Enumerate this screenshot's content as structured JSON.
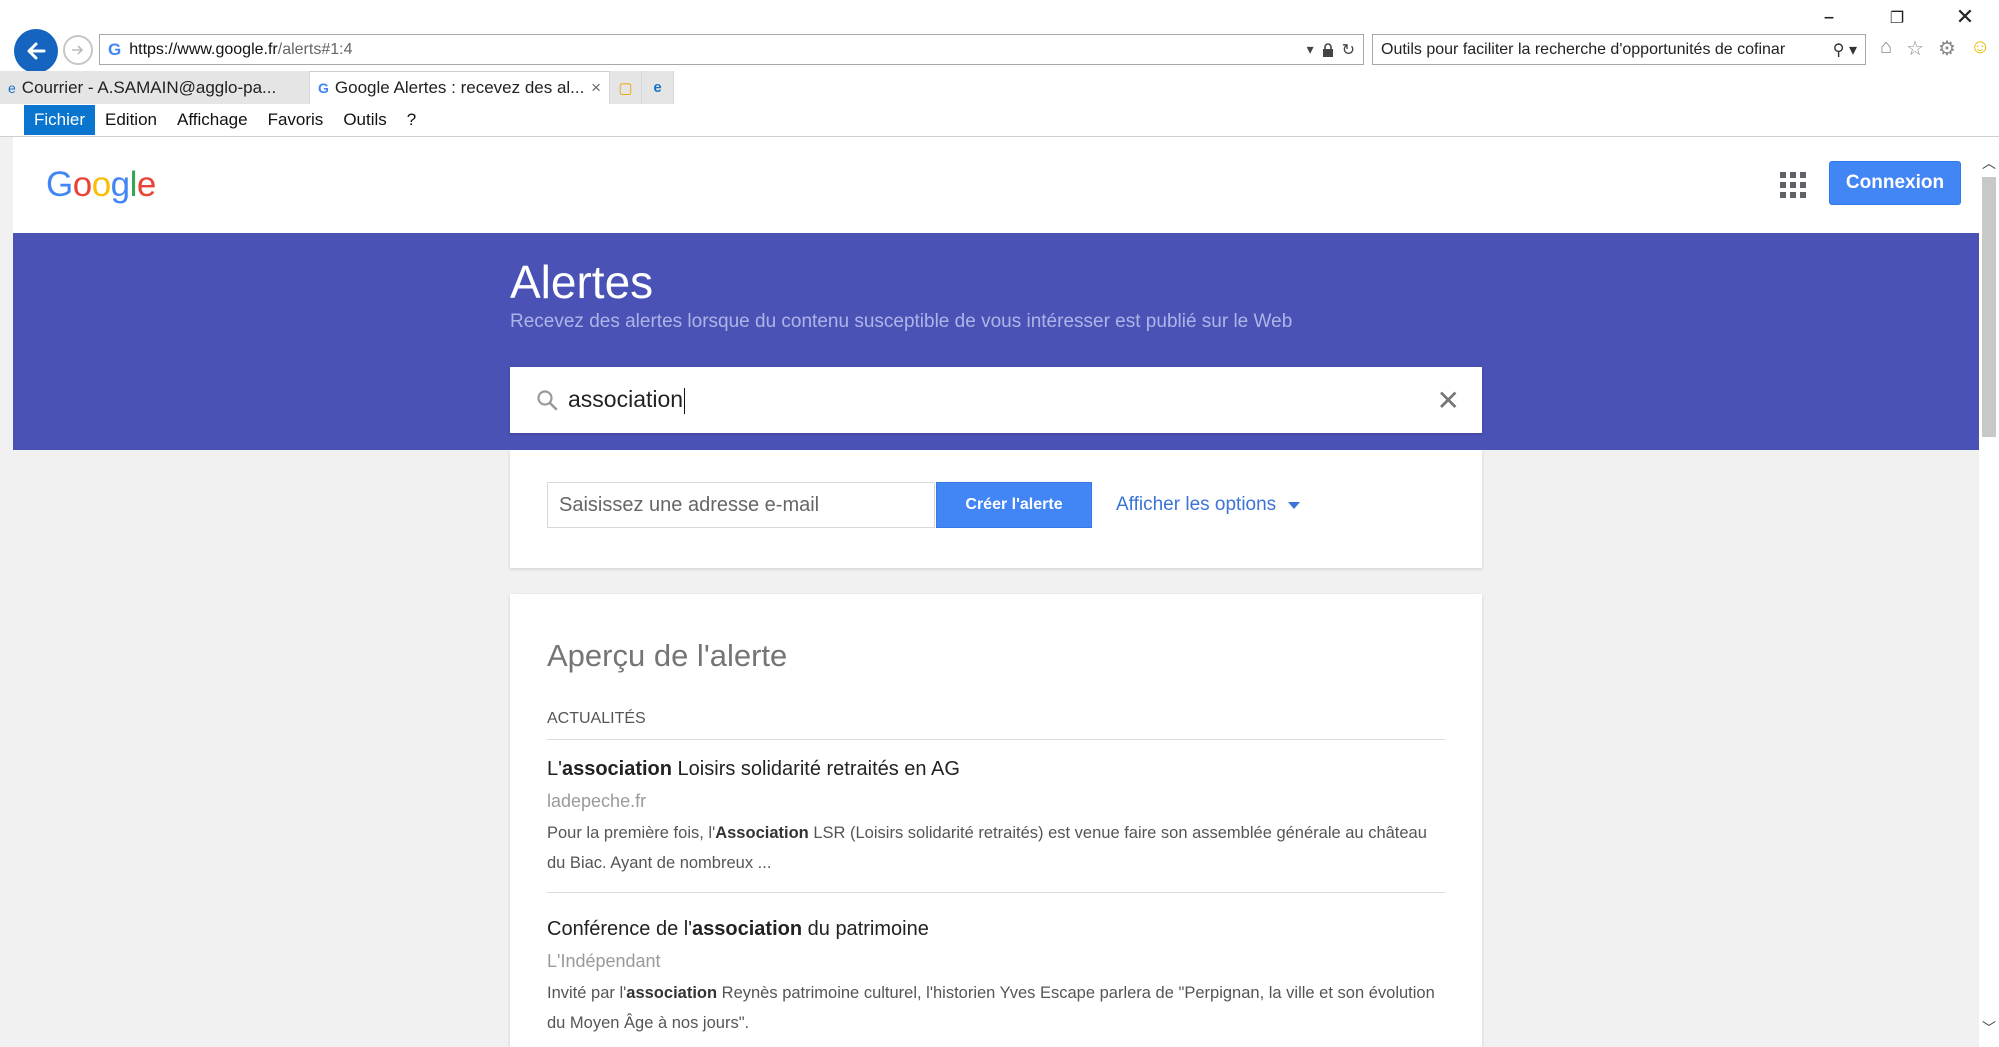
{
  "browser": {
    "window_controls": {
      "minimize": "–",
      "restore": "❐",
      "close": "✕"
    },
    "url_host": "https://www.google.fr",
    "url_path": "/alerts#1:4",
    "search_box": "Outils pour faciliter la recherche d'opportunités de cofinar",
    "tabs": [
      {
        "label": "Courrier - A.SAMAIN@agglo-pa...",
        "icon": "ie-mail-icon"
      },
      {
        "label": "Google Alertes : recevez des al...",
        "icon": "google-g-icon",
        "close": "×"
      }
    ],
    "menu": [
      "Fichier",
      "Edition",
      "Affichage",
      "Favoris",
      "Outils",
      "?"
    ]
  },
  "header": {
    "logo": [
      "G",
      "o",
      "o",
      "g",
      "l",
      "e"
    ],
    "logo_colors": [
      "#4285f4",
      "#ea4335",
      "#fbbc05",
      "#4285f4",
      "#34a853",
      "#ea4335"
    ],
    "connexion": "Connexion"
  },
  "banner": {
    "title": "Alertes",
    "subtitle": "Recevez des alertes lorsque du contenu susceptible de vous intéresser est publié sur le Web",
    "query": "association",
    "clear": "✕",
    "color": "#4a52b6"
  },
  "options": {
    "email_placeholder": "Saisissez une adresse e-mail",
    "create_button": "Créer l'alerte",
    "show_options": "Afficher les options"
  },
  "preview": {
    "title": "Aperçu de l'alerte",
    "section": "ACTUALITÉS",
    "articles": [
      {
        "title_pre": "L'",
        "title_bold": "association",
        "title_post": " Loisirs solidarité retraités en AG",
        "source": "ladepeche.fr",
        "snippet_pre": "Pour la première fois, l'",
        "snippet_bold": "Association",
        "snippet_post": " LSR (Loisirs solidarité retraités) est venue faire son assemblée générale au château du Biac. Ayant de nombreux ..."
      },
      {
        "title_pre": "Conférence de l'",
        "title_bold": "association",
        "title_post": " du patrimoine",
        "source": "L'Indépendant",
        "snippet_pre": "Invité par l'",
        "snippet_bold": "association",
        "snippet_post": " Reynès patrimoine culturel, l'historien Yves Escape parlera de \"Perpignan, la ville et son évolution du Moyen Âge à nos jours\"."
      }
    ]
  }
}
